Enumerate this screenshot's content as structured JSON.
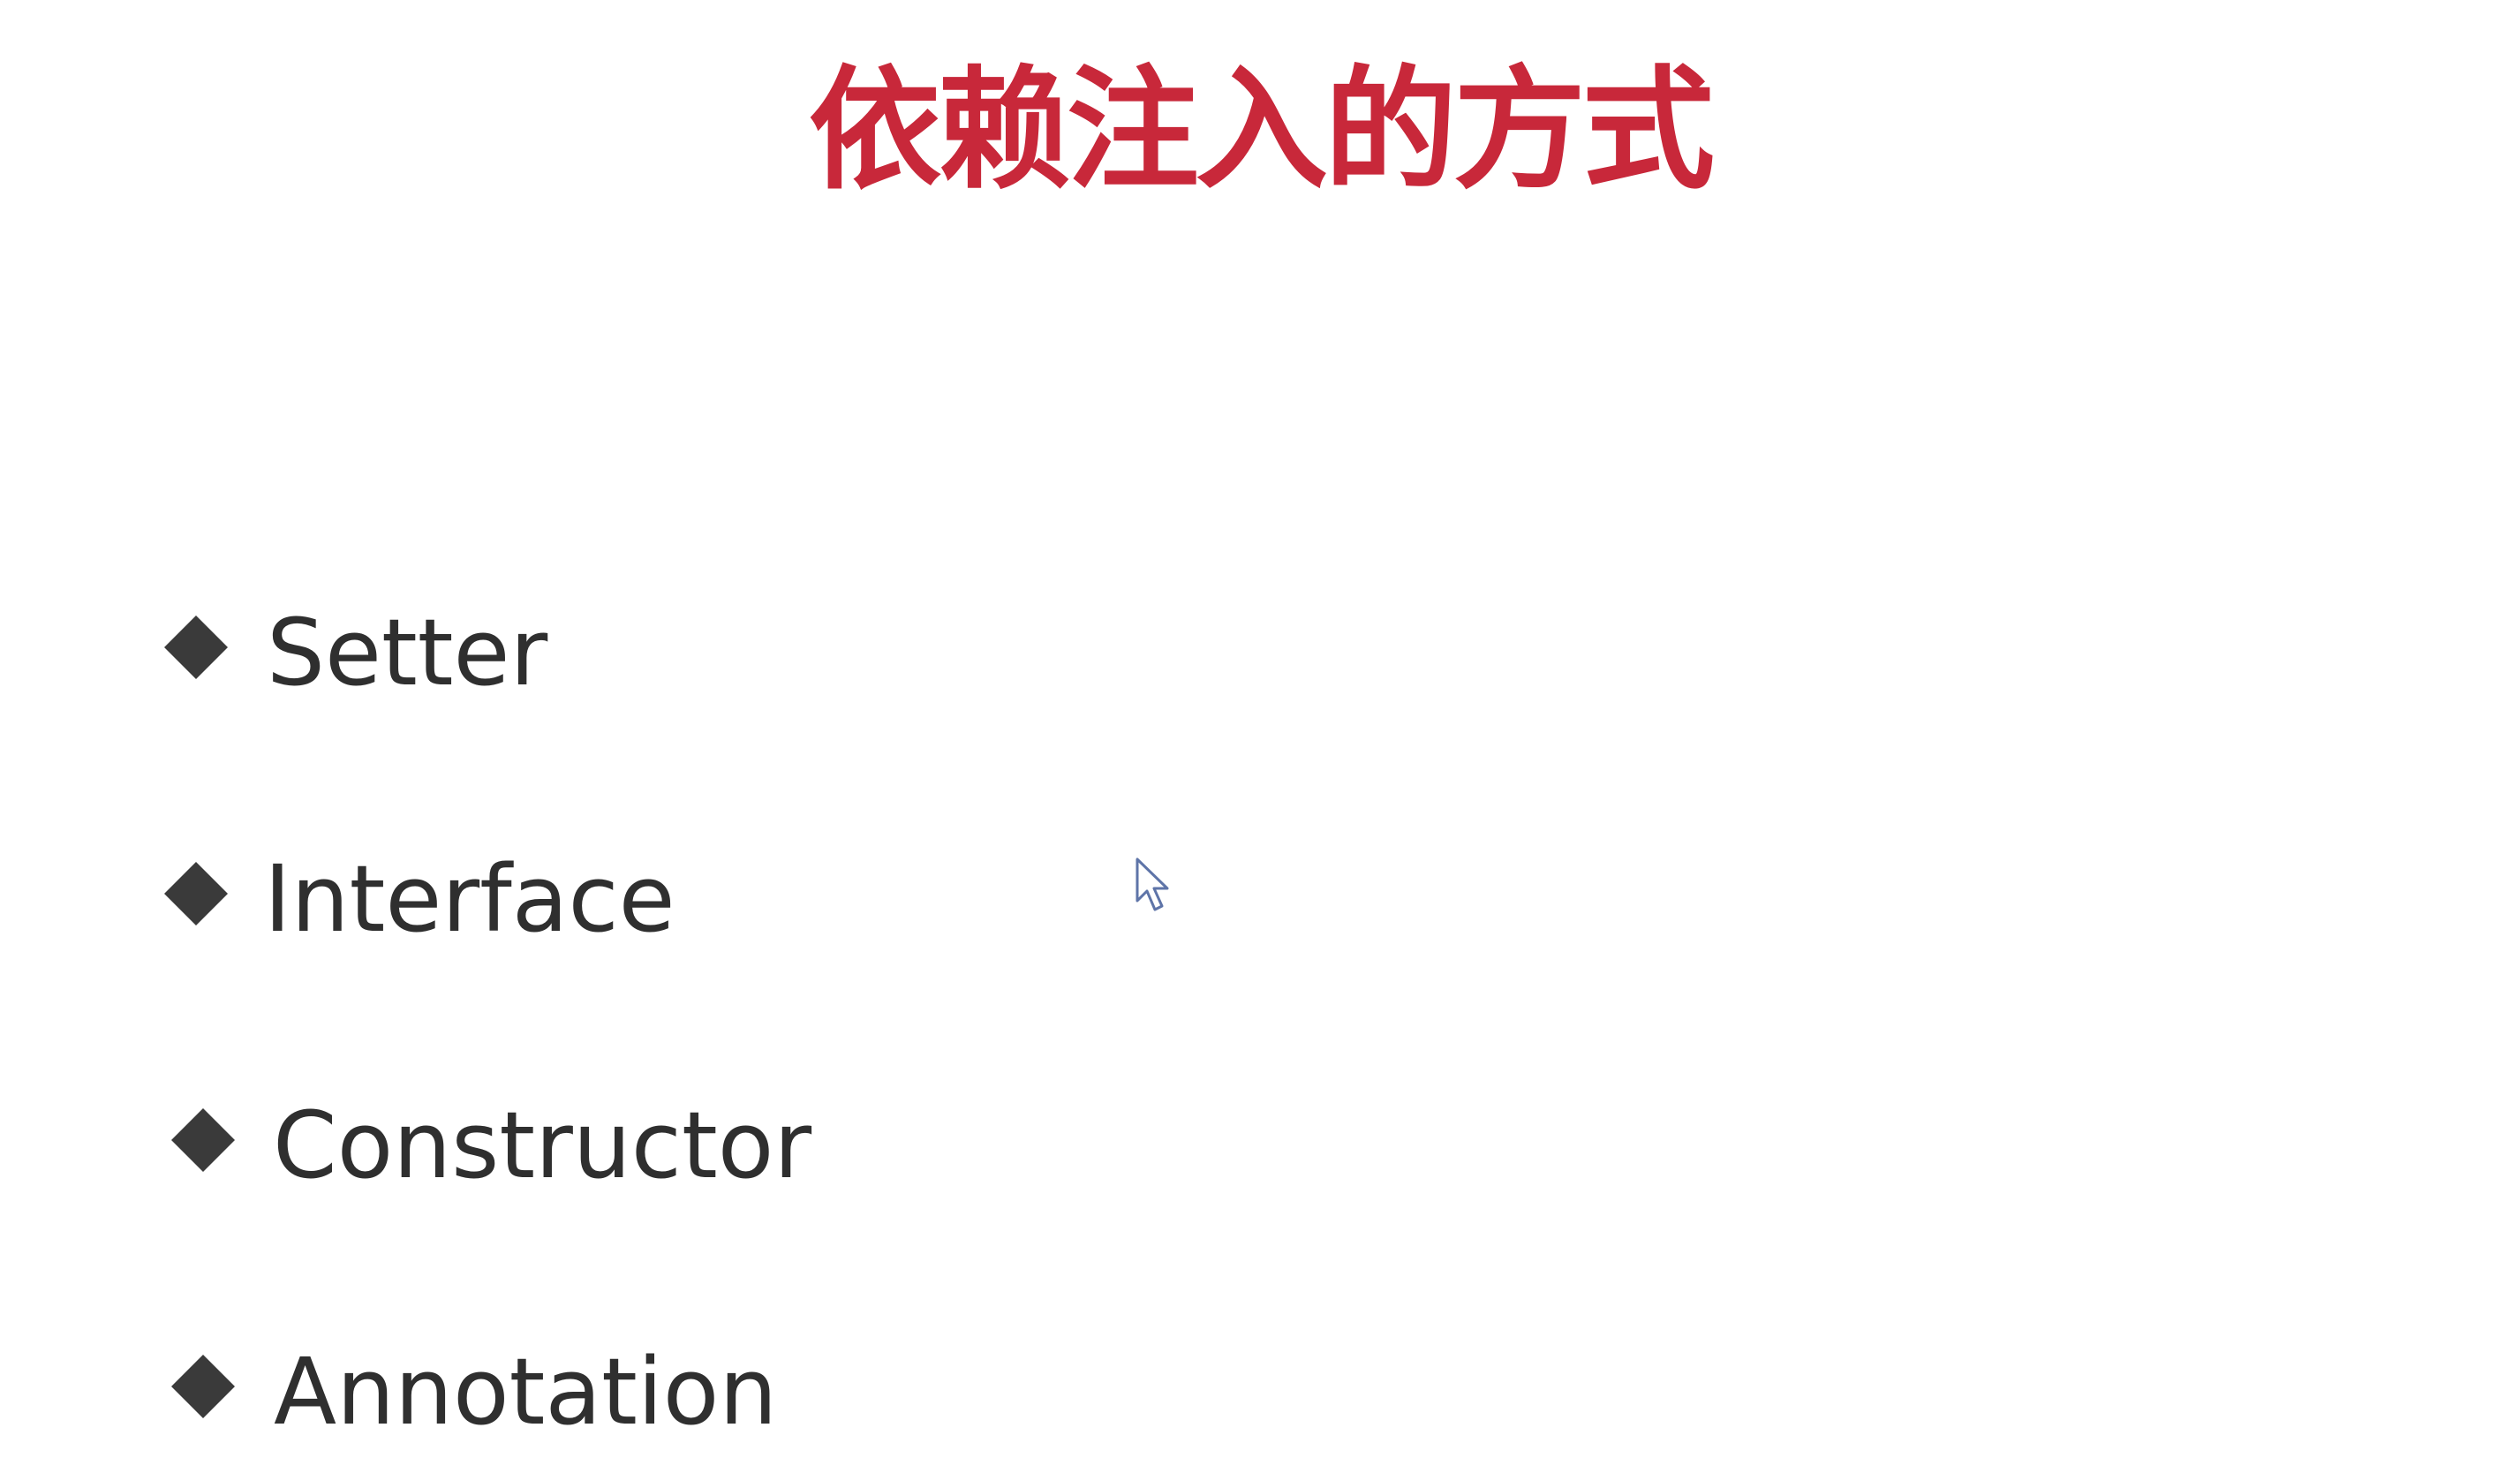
{
  "slide": {
    "title": "依赖注入的方式",
    "title_color": "#c8283a",
    "bullet_color": "#3a3a3a",
    "bullet_icon": "diamond-icon",
    "items": [
      {
        "label": "Setter"
      },
      {
        "label": "Interface"
      },
      {
        "label": "Constructor"
      },
      {
        "label": "Annotation"
      }
    ]
  },
  "cursor": {
    "icon": "mouse-pointer-icon"
  }
}
